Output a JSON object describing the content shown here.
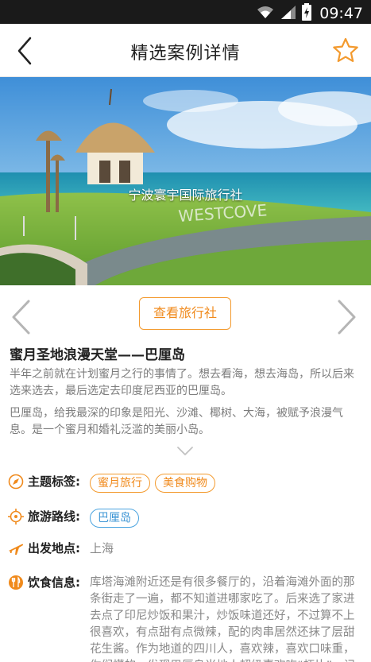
{
  "status": {
    "time": "09:47"
  },
  "header": {
    "title": "精选案例详情"
  },
  "hero": {
    "caption": "宁波寰宇国际旅行社",
    "sign_text": "WESTCOVE"
  },
  "actions": {
    "view_agency": "查看旅行社"
  },
  "case": {
    "title": "蜜月圣地浪漫天堂——巴厘岛",
    "paragraph1": "半年之前就在计划蜜月之行的事情了。想去看海，想去海岛，所以后来选来选去，最后选定去印度尼西亚的巴厘岛。",
    "paragraph2": "巴厘岛，给我最深的印象是阳光、沙滩、椰树、大海，被赋予浪漫气息。是一个蜜月和婚礼泛滥的美丽小岛。"
  },
  "info": {
    "theme_label": "主题标签:",
    "theme_tags": [
      "蜜月旅行",
      "美食购物"
    ],
    "route_label": "旅游路线:",
    "route_tags": [
      "巴厘岛"
    ],
    "depart_label": "出发地点:",
    "depart_value": "上海",
    "food_label": "饮食信息:",
    "food_value": "库塔海滩附近还是有很多餐厅的，沿着海滩外面的那条街走了一遍，都不知道进哪家吃了。后来选了家进去点了印尼炒饭和果汁，炒饭味道还好，不过算不上很喜欢，有点甜有点微辣，配的肉串居然还抹了层甜花生酱。作为地道的四川人，喜欢辣，喜欢口味重，你们懂的。发现巴厘岛当地人超级喜欢吃“虾片”，记得小时"
  },
  "colors": {
    "accent_orange": "#f08a1c",
    "accent_blue": "#3b94d4"
  }
}
